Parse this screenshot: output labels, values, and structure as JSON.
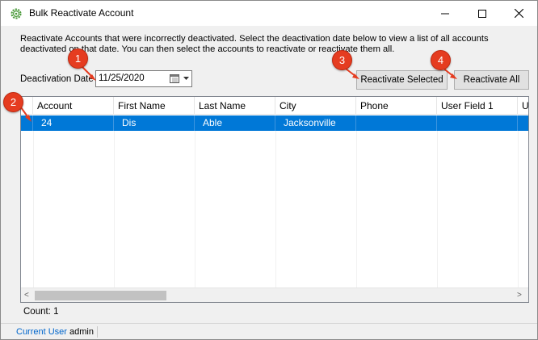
{
  "window": {
    "title": "Bulk Reactivate Account",
    "controls": {
      "minimize": "minimize",
      "maximize": "maximize",
      "close": "close"
    }
  },
  "description": "Reactivate Accounts that were incorrectly deactivated.  Select the deactivation date below to view a list of all accounts deactivated on that date.  You can then select the accounts to reactivate or reactivate them all.",
  "date_filter": {
    "label": "Deactivation Date",
    "value": "11/25/2020"
  },
  "buttons": {
    "reactivate_selected": "Reactivate Selected",
    "reactivate_all": "Reactivate All"
  },
  "grid": {
    "columns": [
      "Account",
      "First Name",
      "Last Name",
      "City",
      "Phone",
      "User Field 1",
      "U"
    ],
    "rows": [
      {
        "account": "24",
        "first_name": "Dis",
        "last_name": "Able",
        "city": "Jacksonville",
        "phone": "",
        "user_field_1": ""
      }
    ],
    "scroll_left": "<",
    "scroll_right": ">"
  },
  "count_text": "Count: 1",
  "status_bar": {
    "label": "Current User",
    "user": "admin"
  },
  "callouts": [
    "1",
    "2",
    "3",
    "4"
  ],
  "colors": {
    "selection": "#0078d7",
    "callout": "#e53c20",
    "status_link": "#0066cc"
  }
}
